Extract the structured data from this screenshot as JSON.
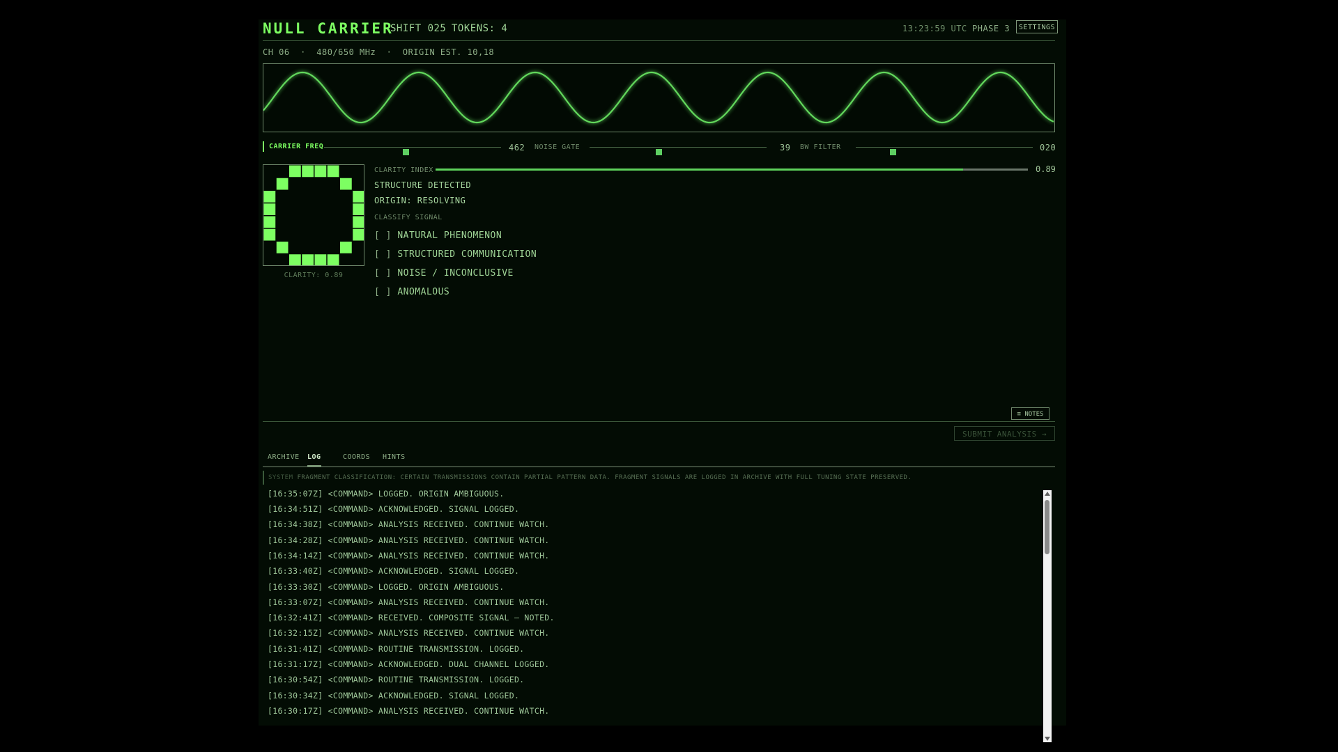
{
  "header": {
    "title": "NULL CARRIER",
    "shift": "SHIFT 025",
    "tokens": "TOKENS: 4",
    "clock": "13:23:59 UTC",
    "phase": "PHASE 3",
    "settings_label": "SETTINGS"
  },
  "channel_line": "CH 06  ·  480/650 MHz  ·  ORIGIN EST. 10,18",
  "sliders": [
    {
      "label": "CARRIER FREQ",
      "value_text": "462",
      "level": 0.46,
      "active": true
    },
    {
      "label": "NOISE GATE",
      "value_text": "39",
      "level": 0.39,
      "active": false
    },
    {
      "label": "BW FILTER",
      "value_text": "020",
      "level": 0.21,
      "active": false
    }
  ],
  "glyph_caption": "CLARITY: 0.89",
  "clarity": {
    "label": "CLARITY INDEX",
    "value": 0.89,
    "value_text": "0.89"
  },
  "status": [
    "STRUCTURE DETECTED",
    "ORIGIN: RESOLVING"
  ],
  "classify": {
    "label": "CLASSIFY SIGNAL",
    "options": [
      "NATURAL PHENOMENON",
      "STRUCTURED COMMUNICATION",
      "NOISE / INCONCLUSIVE",
      "ANOMALOUS"
    ],
    "bracket": "[ ]"
  },
  "notes_label": "≡ NOTES",
  "submit_label": "SUBMIT ANALYSIS →",
  "tabs": [
    {
      "label": "ARCHIVE",
      "active": false
    },
    {
      "label": "LOG",
      "active": true
    },
    {
      "label": "COORDS",
      "active": false
    },
    {
      "label": "HINTS",
      "active": false
    }
  ],
  "system_line": {
    "tag": "SYSTEM",
    "text": "FRAGMENT CLASSIFICATION: CERTAIN TRANSMISSIONS CONTAIN PARTIAL PATTERN DATA. FRAGMENT SIGNALS ARE LOGGED IN ARCHIVE WITH FULL TUNING STATE PRESERVED."
  },
  "log": [
    "[16:35:07Z] <COMMAND> LOGGED. ORIGIN AMBIGUOUS.",
    "[16:34:51Z] <COMMAND> ACKNOWLEDGED. SIGNAL LOGGED.",
    "[16:34:38Z] <COMMAND> ANALYSIS RECEIVED. CONTINUE WATCH.",
    "[16:34:28Z] <COMMAND> ANALYSIS RECEIVED. CONTINUE WATCH.",
    "[16:34:14Z] <COMMAND> ANALYSIS RECEIVED. CONTINUE WATCH.",
    "[16:33:40Z] <COMMAND> ACKNOWLEDGED. SIGNAL LOGGED.",
    "[16:33:30Z] <COMMAND> LOGGED. ORIGIN AMBIGUOUS.",
    "[16:33:07Z] <COMMAND> ANALYSIS RECEIVED. CONTINUE WATCH.",
    "[16:32:41Z] <COMMAND> RECEIVED. COMPOSITE SIGNAL — NOTED.",
    "[16:32:15Z] <COMMAND> ANALYSIS RECEIVED. CONTINUE WATCH.",
    "[16:31:41Z] <COMMAND> ROUTINE TRANSMISSION. LOGGED.",
    "[16:31:17Z] <COMMAND> ACKNOWLEDGED. DUAL CHANNEL LOGGED.",
    "[16:30:54Z] <COMMAND> ROUTINE TRANSMISSION. LOGGED.",
    "[16:30:34Z] <COMMAND> ACKNOWLEDGED. SIGNAL LOGGED.",
    "[16:30:17Z] <COMMAND> ANALYSIS RECEIVED. CONTINUE WATCH."
  ],
  "colors": {
    "accent": "#7dff62",
    "wave": "#62d85c",
    "glyph": "#7dff62"
  },
  "glyph_pattern": [
    "00111100",
    "01000010",
    "10000001",
    "10000001",
    "10000001",
    "10000001",
    "01000010",
    "00111100"
  ]
}
